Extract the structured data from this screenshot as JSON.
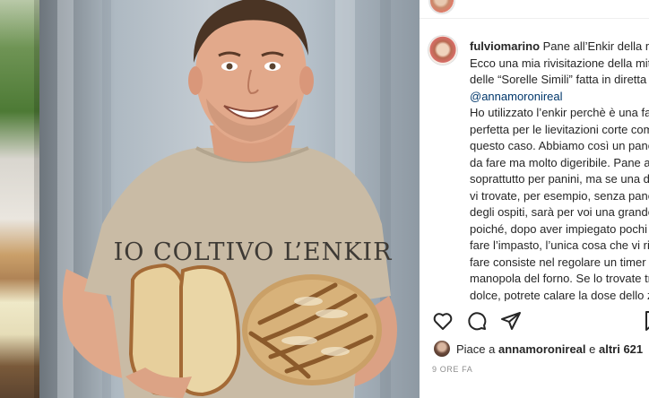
{
  "post": {
    "username": "fulviomarino",
    "caption_first_line": "Pane all’Enkir della mezz’ora",
    "caption_intro": "Ecco una mia rivisitazione della mitica ricetta delle “Sorelle Simili” fatta in diretta con ",
    "mention": "@annamoronireal",
    "caption_body": "Ho utilizzato l’enkir perchè è una farina perfetta per le lievitazioni corte come in questo caso. Abbiamo così un pane veloce da fare ma molto digeribile. Pane adatto soprattutto per panini, ma se una domenica vi trovate, per esempio, senza pane e avete degli ospiti, sarà per voi una grande risorsa poiché, dopo aver impiegato pochi minuti per fare l’impasto, l’unica cosa che vi rimane da fare consiste nel regolare un timer e girare la manopola del forno. Se lo trovate troppo dolce, potrete calare la dose dello zucchero"
  },
  "photo": {
    "shirt_text": "IO COLTIVO L’ENKIR"
  },
  "actions": {
    "like_icon": "heart-icon",
    "comment_icon": "comment-icon",
    "share_icon": "paper-plane-icon",
    "save_icon": "bookmark-icon"
  },
  "likes": {
    "prefix": "Piace a ",
    "liker": "annamoronireal",
    "middle": " e ",
    "others": "altri 621"
  },
  "timestamp": "9 ORE FA"
}
